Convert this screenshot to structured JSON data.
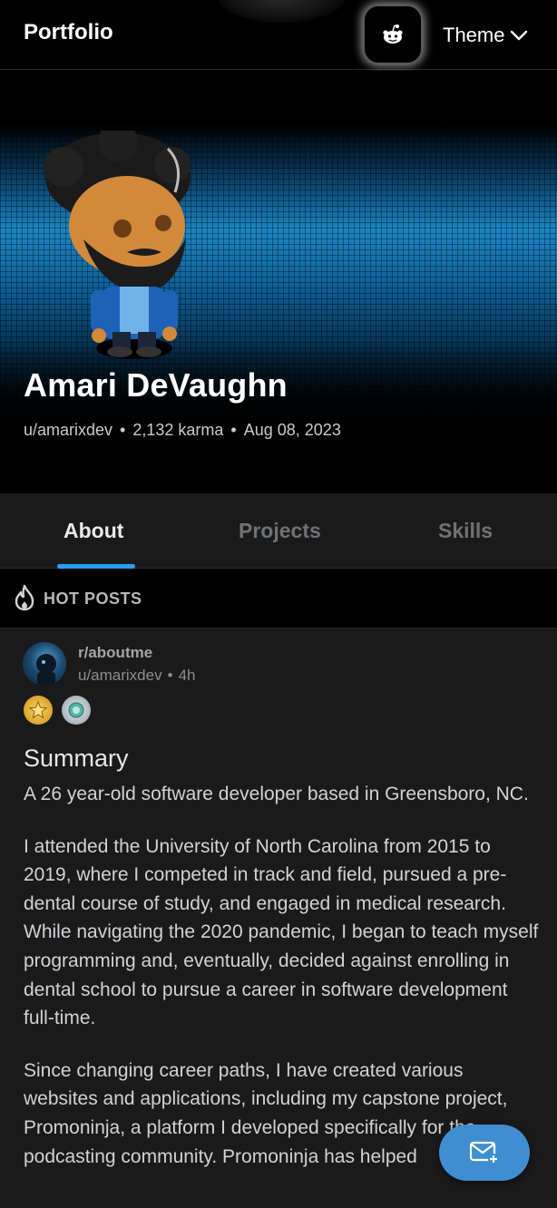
{
  "header": {
    "brand": "Portfolio",
    "theme_label": "Theme",
    "reddit_icon": "reddit-snoo-icon",
    "chevron_icon": "chevron-down-icon"
  },
  "profile": {
    "name": "Amari DeVaughn",
    "username": "u/amarixdev",
    "karma": "2,132 karma",
    "joined": "Aug 08, 2023",
    "separator": "•"
  },
  "tabs": [
    {
      "label": "About",
      "active": true
    },
    {
      "label": "Projects",
      "active": false
    },
    {
      "label": "Skills",
      "active": false
    }
  ],
  "section": {
    "label": "HOT POSTS",
    "icon": "flame-icon"
  },
  "post": {
    "subreddit": "r/aboutme",
    "author": "u/amarixdev",
    "age": "4h",
    "separator": "•",
    "title": "Summary",
    "paragraphs": [
      "A 26 year-old software developer based in Greensboro, NC.",
      "I attended the University of North Carolina from 2015 to 2019, where I competed in track and field, pursued a pre-dental course of study, and engaged in medical research. While navigating the 2020 pandemic, I began to teach myself programming and, eventually, decided against enrolling in dental school to pursue a career in software development full-time.",
      "Since changing career paths, I have created various websites and applications, including my capstone project, Promoninja, a platform I developed specifically for the podcasting community. Promoninja has helped"
    ]
  },
  "colors": {
    "accent": "#24a0ed",
    "fab": "#3f8fd0",
    "card": "#1a1a1b",
    "background": "#000000"
  },
  "fab": {
    "icon": "mail-plus-icon"
  }
}
